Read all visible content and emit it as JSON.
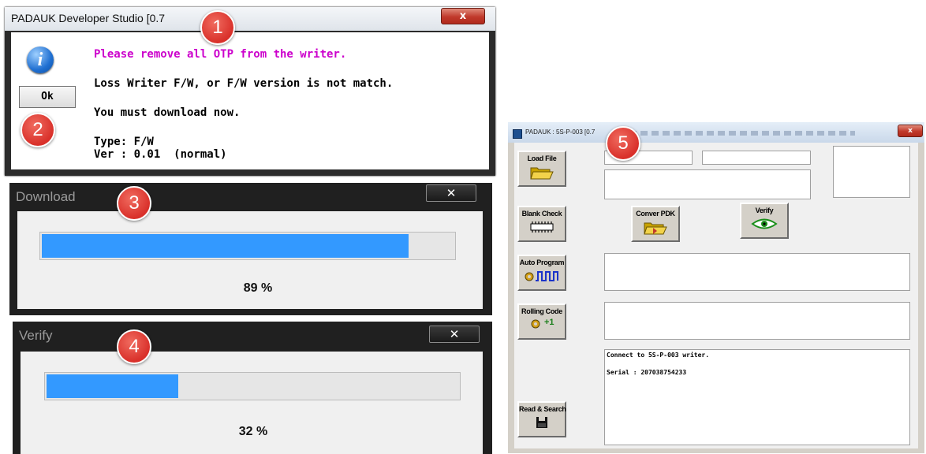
{
  "badges": [
    "1",
    "2",
    "3",
    "4",
    "5"
  ],
  "dialog1": {
    "title": "PADAUK Developer Studio [0.7",
    "close_label": "x",
    "ok_label": "Ok",
    "icon": "info-icon",
    "lines": {
      "line1": "Please remove all OTP from the writer.",
      "line2": "Loss Writer F/W, or F/W version is not match.",
      "line3": "You must download now.",
      "line4": "Type: F/W",
      "line5": "Ver : 0.01  (normal)"
    },
    "line1_color": "#cc00cc"
  },
  "download": {
    "title": "Download",
    "close_label": "✕",
    "percent_text": "89 %",
    "progress": 0.89
  },
  "verify": {
    "title": "Verify",
    "close_label": "✕",
    "percent_text": "32 %",
    "progress": 0.32
  },
  "writer": {
    "title": "PADAUK : 5S-P-003 [0.7",
    "close_label": "x",
    "buttons": {
      "load_file": "Load File",
      "blank_check": "Blank Check",
      "conver_pdk": "Conver PDK",
      "verify": "Verify",
      "auto_program": "Auto Program",
      "rolling_code": "Rolling Code",
      "rolling_code_value": "+1",
      "read_search": "Read & Search"
    },
    "log": {
      "line1": "Connect to 5S-P-003 writer.",
      "line2": "Serial : 207038754233"
    }
  },
  "colors": {
    "badge": "#d9302a",
    "progress": "#3399ff",
    "accent_magenta": "#cc00cc"
  }
}
